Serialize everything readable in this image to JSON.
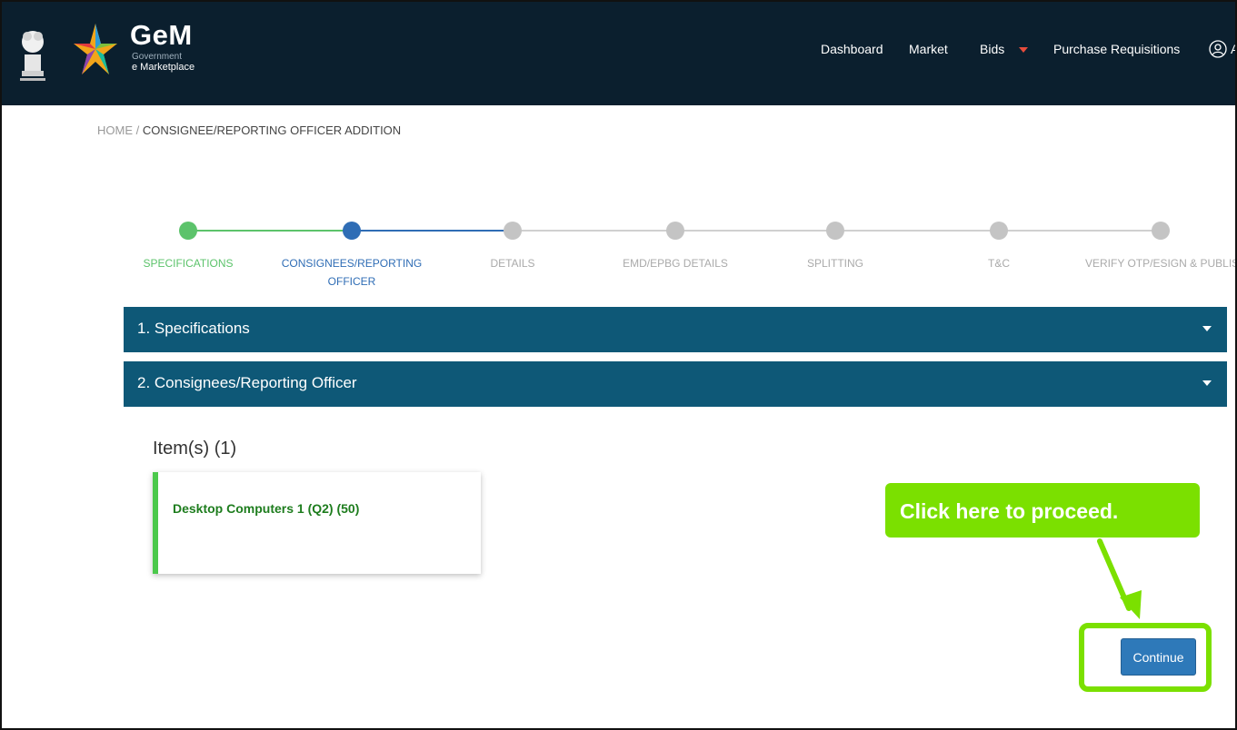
{
  "header": {
    "brand_name": "GeM",
    "brand_sub1": "Government",
    "brand_sub2": "e Marketplace",
    "nav": {
      "dashboard": "Dashboard",
      "market": "Market",
      "bids": "Bids",
      "purchase_requisitions": "Purchase Requisitions",
      "user_truncated": "A"
    }
  },
  "breadcrumb": {
    "home": "HOME",
    "separator": " / ",
    "current": "CONSIGNEE/REPORTING OFFICER ADDITION"
  },
  "stepper": {
    "steps": [
      {
        "label": "SPECIFICATIONS",
        "state": "done"
      },
      {
        "label": "CONSIGNEES/REPORTING OFFICER",
        "state": "active"
      },
      {
        "label": "DETAILS",
        "state": "pending"
      },
      {
        "label": "EMD/EPBG DETAILS",
        "state": "pending"
      },
      {
        "label": "SPLITTING",
        "state": "pending"
      },
      {
        "label": "T&C",
        "state": "pending"
      },
      {
        "label": "VERIFY OTP/ESIGN & PUBLISH",
        "state": "pending"
      }
    ]
  },
  "sections": [
    {
      "title": "1. Specifications"
    },
    {
      "title": "2. Consignees/Reporting Officer"
    }
  ],
  "items": {
    "title": "Item(s) (1)",
    "list": [
      {
        "text": "Desktop Computers 1  (Q2)  (50)"
      }
    ]
  },
  "callout": {
    "text": "Click here to proceed."
  },
  "continue_label": "Continue",
  "colors": {
    "header_bg": "#0b1f2e",
    "section_bg": "#0e5877",
    "step_done": "#5cc36b",
    "step_active": "#2f6db5",
    "step_pending": "#c4c4c4",
    "callout": "#7be000",
    "button": "#2e79b9"
  }
}
